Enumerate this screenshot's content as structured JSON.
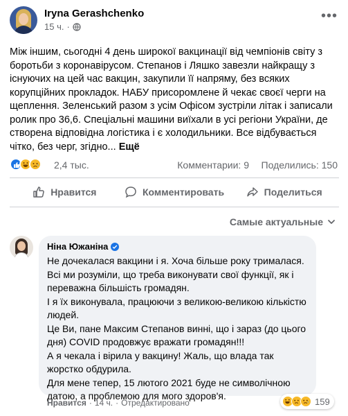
{
  "post": {
    "author": "Iryna Gerashchenko",
    "time": "15 ч.",
    "separator": "·",
    "text": "Між іншим, сьогодні 4 день широкої вакцинації від чемпіонів світу з боротьби з коронавірусом. Степанов і Ляшко завезли найкращу з існуючих на цей час  вакцин, закупили її напряму, без всяких корупційних прокладок. НАБУ присоромлене й чекає своєї черги на щеплення. Зеленський разом  з усім Офісом зустріли літак і записали ролик про 36,6. Спеціальні  машини виїхали в усі регіони України, де створена відповідна логістика і є холодильники. Все відбувається чітко, без черг, згідно...",
    "more_label": "Ещё",
    "reactions_count": "2,4 тыс.",
    "comments_label": "Комментарии: 9",
    "shares_label": "Поделились: 150",
    "like_label": "Нравится",
    "comment_label": "Комментировать",
    "share_label": "Поделиться"
  },
  "comments": {
    "sort_label": "Самые актуальные",
    "items": [
      {
        "author": "Ніна Южаніна",
        "paragraphs": [
          "Не дочекалася вакцини і я. Хоча більше року трималася. Всі ми розуміли, що треба виконувати свої функції, як і переважна більшість громадян.",
          "І я їх виконувала, працюючи з великою-великою кількістю людей.",
          "Це Ви, пане Максим Степанов винні, що і зараз (до цього дня) COVID продовжує вражати громадян!!!",
          "А я чекала і вірила у вакцину! Жаль, що влада так жорстко обдурила.",
          "Для мене тепер, 15 лютого 2021 буде не символічною датою, а проблемою для мого здоров'я."
        ],
        "like_label": "Нравится",
        "separator": "·",
        "time": "14 ч.",
        "edited_label": "Отредактировано",
        "reactions_count": "159"
      }
    ]
  },
  "colors": {
    "accent": "#1b74e4",
    "muted": "#65676b",
    "bubble": "#f0f2f5",
    "reaction_yellow": "#f7b928"
  },
  "icons": [
    "globe-icon",
    "more-icon",
    "like-reaction-icon",
    "haha-reaction-icon",
    "sad-reaction-icon",
    "thumbs-up-icon",
    "comment-icon",
    "share-icon",
    "chevron-down-icon",
    "verified-icon"
  ]
}
